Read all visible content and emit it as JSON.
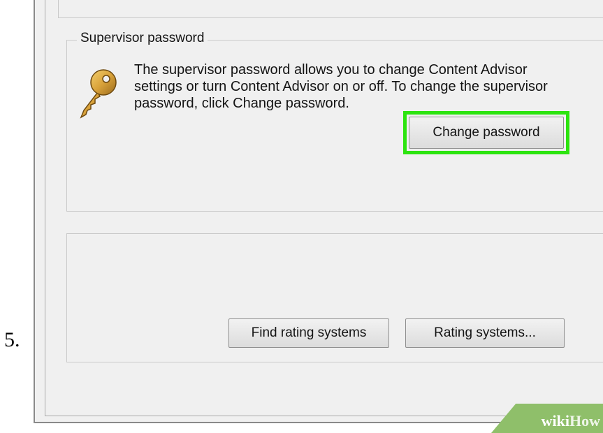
{
  "step": {
    "number": "5."
  },
  "supervisor_password": {
    "legend": "Supervisor password",
    "description": "The supervisor password allows you to change Content Advisor settings or turn Content Advisor on or off. To change the supervisor password, click Change password.",
    "change_button": "Change password"
  },
  "rating_systems": {
    "find_button": "Find rating systems",
    "rating_button": "Rating systems..."
  },
  "watermark": {
    "wiki": "wiki",
    "how": "How"
  },
  "icons": {
    "key": "key-icon"
  },
  "colors": {
    "highlight": "#2ce40f",
    "key_gold": "#d9a23a"
  }
}
